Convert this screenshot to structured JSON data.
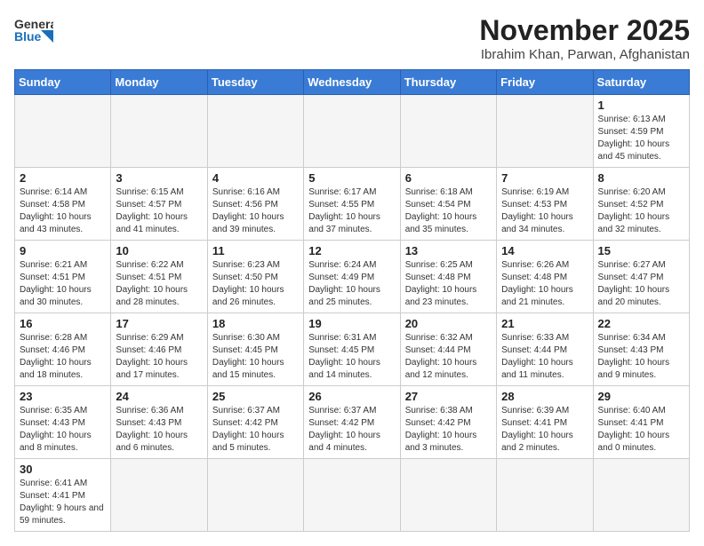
{
  "header": {
    "logo_general": "General",
    "logo_blue": "Blue",
    "title": "November 2025",
    "subtitle": "Ibrahim Khan, Parwan, Afghanistan"
  },
  "days_of_week": [
    "Sunday",
    "Monday",
    "Tuesday",
    "Wednesday",
    "Thursday",
    "Friday",
    "Saturday"
  ],
  "weeks": [
    [
      {
        "day": "",
        "info": ""
      },
      {
        "day": "",
        "info": ""
      },
      {
        "day": "",
        "info": ""
      },
      {
        "day": "",
        "info": ""
      },
      {
        "day": "",
        "info": ""
      },
      {
        "day": "",
        "info": ""
      },
      {
        "day": "1",
        "info": "Sunrise: 6:13 AM\nSunset: 4:59 PM\nDaylight: 10 hours and 45 minutes."
      }
    ],
    [
      {
        "day": "2",
        "info": "Sunrise: 6:14 AM\nSunset: 4:58 PM\nDaylight: 10 hours and 43 minutes."
      },
      {
        "day": "3",
        "info": "Sunrise: 6:15 AM\nSunset: 4:57 PM\nDaylight: 10 hours and 41 minutes."
      },
      {
        "day": "4",
        "info": "Sunrise: 6:16 AM\nSunset: 4:56 PM\nDaylight: 10 hours and 39 minutes."
      },
      {
        "day": "5",
        "info": "Sunrise: 6:17 AM\nSunset: 4:55 PM\nDaylight: 10 hours and 37 minutes."
      },
      {
        "day": "6",
        "info": "Sunrise: 6:18 AM\nSunset: 4:54 PM\nDaylight: 10 hours and 35 minutes."
      },
      {
        "day": "7",
        "info": "Sunrise: 6:19 AM\nSunset: 4:53 PM\nDaylight: 10 hours and 34 minutes."
      },
      {
        "day": "8",
        "info": "Sunrise: 6:20 AM\nSunset: 4:52 PM\nDaylight: 10 hours and 32 minutes."
      }
    ],
    [
      {
        "day": "9",
        "info": "Sunrise: 6:21 AM\nSunset: 4:51 PM\nDaylight: 10 hours and 30 minutes."
      },
      {
        "day": "10",
        "info": "Sunrise: 6:22 AM\nSunset: 4:51 PM\nDaylight: 10 hours and 28 minutes."
      },
      {
        "day": "11",
        "info": "Sunrise: 6:23 AM\nSunset: 4:50 PM\nDaylight: 10 hours and 26 minutes."
      },
      {
        "day": "12",
        "info": "Sunrise: 6:24 AM\nSunset: 4:49 PM\nDaylight: 10 hours and 25 minutes."
      },
      {
        "day": "13",
        "info": "Sunrise: 6:25 AM\nSunset: 4:48 PM\nDaylight: 10 hours and 23 minutes."
      },
      {
        "day": "14",
        "info": "Sunrise: 6:26 AM\nSunset: 4:48 PM\nDaylight: 10 hours and 21 minutes."
      },
      {
        "day": "15",
        "info": "Sunrise: 6:27 AM\nSunset: 4:47 PM\nDaylight: 10 hours and 20 minutes."
      }
    ],
    [
      {
        "day": "16",
        "info": "Sunrise: 6:28 AM\nSunset: 4:46 PM\nDaylight: 10 hours and 18 minutes."
      },
      {
        "day": "17",
        "info": "Sunrise: 6:29 AM\nSunset: 4:46 PM\nDaylight: 10 hours and 17 minutes."
      },
      {
        "day": "18",
        "info": "Sunrise: 6:30 AM\nSunset: 4:45 PM\nDaylight: 10 hours and 15 minutes."
      },
      {
        "day": "19",
        "info": "Sunrise: 6:31 AM\nSunset: 4:45 PM\nDaylight: 10 hours and 14 minutes."
      },
      {
        "day": "20",
        "info": "Sunrise: 6:32 AM\nSunset: 4:44 PM\nDaylight: 10 hours and 12 minutes."
      },
      {
        "day": "21",
        "info": "Sunrise: 6:33 AM\nSunset: 4:44 PM\nDaylight: 10 hours and 11 minutes."
      },
      {
        "day": "22",
        "info": "Sunrise: 6:34 AM\nSunset: 4:43 PM\nDaylight: 10 hours and 9 minutes."
      }
    ],
    [
      {
        "day": "23",
        "info": "Sunrise: 6:35 AM\nSunset: 4:43 PM\nDaylight: 10 hours and 8 minutes."
      },
      {
        "day": "24",
        "info": "Sunrise: 6:36 AM\nSunset: 4:43 PM\nDaylight: 10 hours and 6 minutes."
      },
      {
        "day": "25",
        "info": "Sunrise: 6:37 AM\nSunset: 4:42 PM\nDaylight: 10 hours and 5 minutes."
      },
      {
        "day": "26",
        "info": "Sunrise: 6:37 AM\nSunset: 4:42 PM\nDaylight: 10 hours and 4 minutes."
      },
      {
        "day": "27",
        "info": "Sunrise: 6:38 AM\nSunset: 4:42 PM\nDaylight: 10 hours and 3 minutes."
      },
      {
        "day": "28",
        "info": "Sunrise: 6:39 AM\nSunset: 4:41 PM\nDaylight: 10 hours and 2 minutes."
      },
      {
        "day": "29",
        "info": "Sunrise: 6:40 AM\nSunset: 4:41 PM\nDaylight: 10 hours and 0 minutes."
      }
    ],
    [
      {
        "day": "30",
        "info": "Sunrise: 6:41 AM\nSunset: 4:41 PM\nDaylight: 9 hours and 59 minutes."
      },
      {
        "day": "",
        "info": ""
      },
      {
        "day": "",
        "info": ""
      },
      {
        "day": "",
        "info": ""
      },
      {
        "day": "",
        "info": ""
      },
      {
        "day": "",
        "info": ""
      },
      {
        "day": "",
        "info": ""
      }
    ]
  ]
}
